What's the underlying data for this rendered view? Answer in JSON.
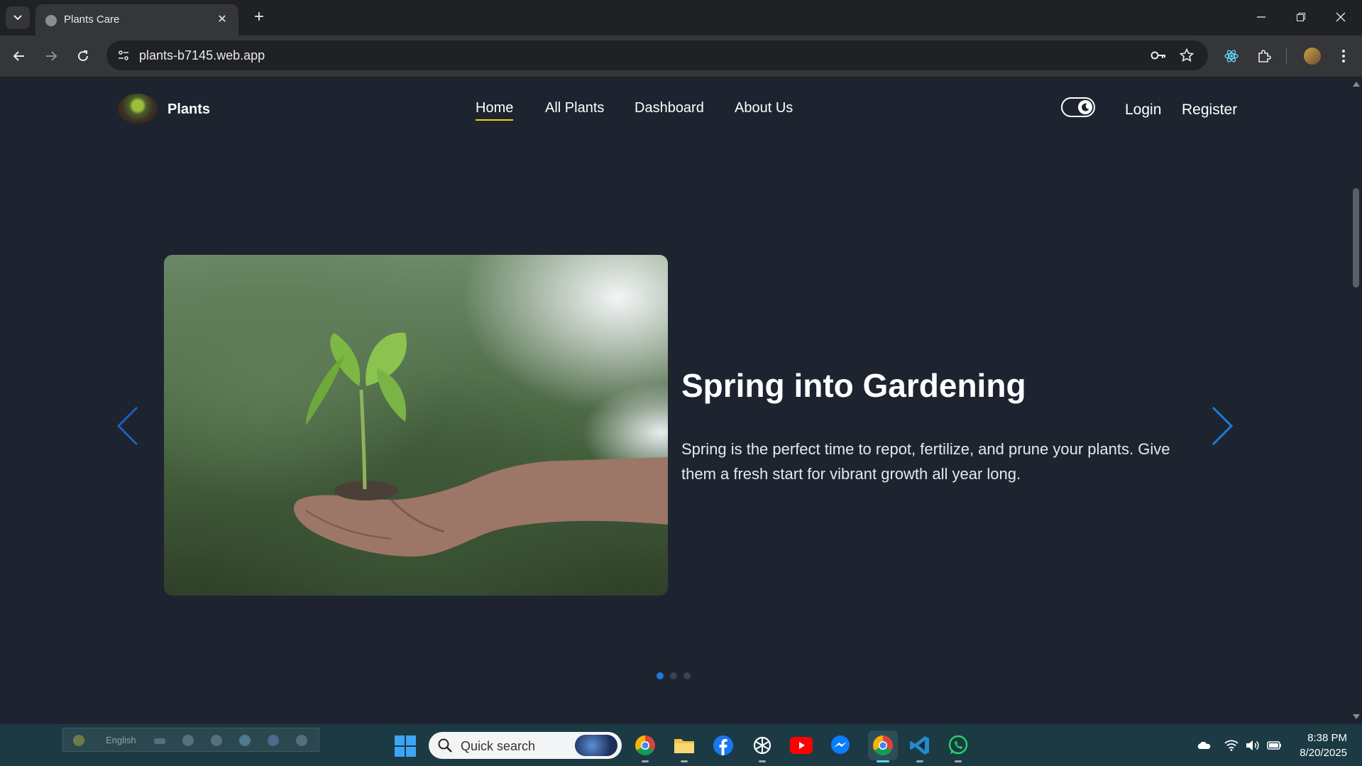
{
  "browser": {
    "tab_title": "Plants Care",
    "url": "plants-b7145.web.app"
  },
  "navbar": {
    "brand": "Plants",
    "links": [
      {
        "label": "Home",
        "active": true
      },
      {
        "label": "All Plants"
      },
      {
        "label": "Dashboard"
      },
      {
        "label": "About Us"
      }
    ],
    "login": "Login",
    "register": "Register"
  },
  "slider": {
    "title": "Spring into Gardening",
    "description": "Spring is the perfect time to repot, fertilize, and prune your plants. Give them a fresh start for vibrant growth all year long.",
    "slide_count": 3,
    "active_index": 0,
    "accent_color": "#1e7bd8"
  },
  "taskbar": {
    "language": "English",
    "search_placeholder": "Quick search",
    "apps": [
      "chrome-icon",
      "file-explorer-icon",
      "facebook-icon",
      "chatgpt-icon",
      "youtube-icon",
      "messenger-icon",
      "chrome-active-icon",
      "vscode-icon",
      "whatsapp-icon"
    ],
    "time": "8:38 PM",
    "date": "8/20/2025"
  }
}
